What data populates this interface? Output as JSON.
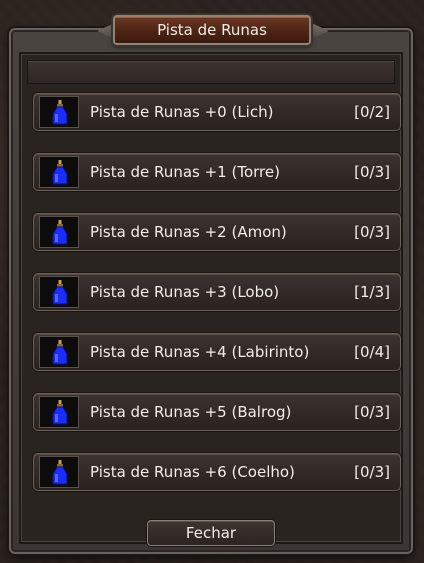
{
  "window": {
    "title": "Pista de Runas"
  },
  "entries": [
    {
      "label": "Pista de Runas +0 (Lich)",
      "count": "[0/2]",
      "icon": "blue-potion-icon"
    },
    {
      "label": "Pista de Runas +1 (Torre)",
      "count": "[0/3]",
      "icon": "blue-potion-icon"
    },
    {
      "label": "Pista de Runas +2 (Amon)",
      "count": "[0/3]",
      "icon": "blue-potion-icon"
    },
    {
      "label": "Pista de Runas +3 (Lobo)",
      "count": "[1/3]",
      "icon": "blue-potion-icon"
    },
    {
      "label": "Pista de Runas +4 (Labirinto)",
      "count": "[0/4]",
      "icon": "blue-potion-icon"
    },
    {
      "label": "Pista de Runas +5 (Balrog)",
      "count": "[0/3]",
      "icon": "blue-potion-icon"
    },
    {
      "label": "Pista de Runas +6 (Coelho)",
      "count": "[0/3]",
      "icon": "blue-potion-icon"
    }
  ],
  "footer": {
    "close_label": "Fechar"
  },
  "colors": {
    "title_plate": "#5a2a18",
    "panel": "#2a2420",
    "potion_blue": "#1a2cff",
    "text": "#f2eee8"
  }
}
